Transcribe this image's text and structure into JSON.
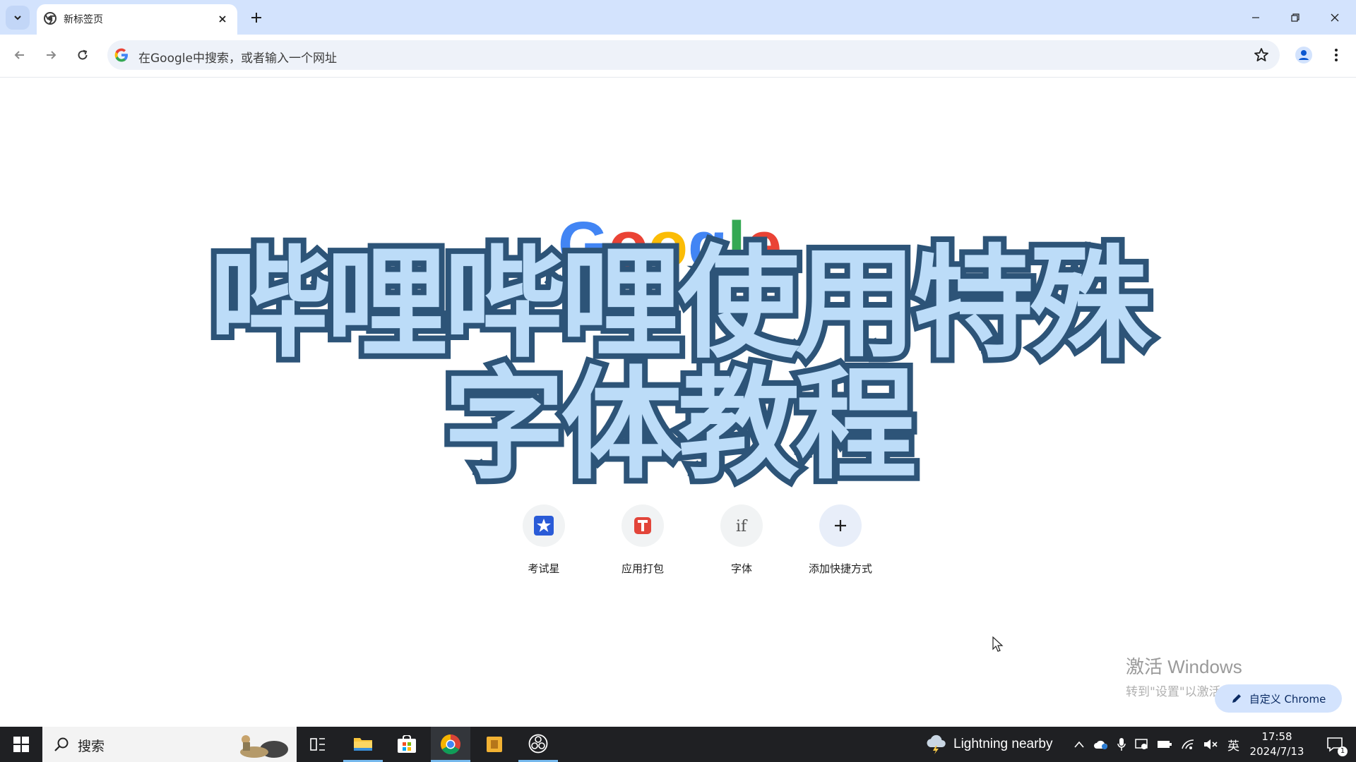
{
  "browser": {
    "tab_title": "新标签页",
    "omnibox_placeholder": "在Google中搜索，或者输入一个网址"
  },
  "page": {
    "logo_text": "Google",
    "overlay_line1": "哔哩哔哩使用特殊",
    "overlay_line2": "字体教程",
    "shortcuts": [
      {
        "label": "考试星",
        "icon": "star-app-icon",
        "color": "#2a5bd7"
      },
      {
        "label": "应用打包",
        "icon": "t-app-icon",
        "color": "#e2453a"
      },
      {
        "label": "字体",
        "icon": "font-if-icon",
        "color": "#555555"
      },
      {
        "label": "添加快捷方式",
        "icon": "plus-icon",
        "color": "#1f1f1f"
      }
    ],
    "activate_title": "激活 Windows",
    "activate_sub": "转到\"设置\"以激活 Windows。",
    "customize_label": "自定义 Chrome"
  },
  "taskbar": {
    "search_label": "搜索",
    "weather_text": "Lightning nearby",
    "ime": "英",
    "time": "17:58",
    "date": "2024/7/13",
    "notification_count": "1"
  },
  "colors": {
    "tabstrip": "#d3e3fd",
    "overlay_fill": "#bcdcf8",
    "overlay_stroke": "#2d5478",
    "taskbar": "#1f2023"
  }
}
